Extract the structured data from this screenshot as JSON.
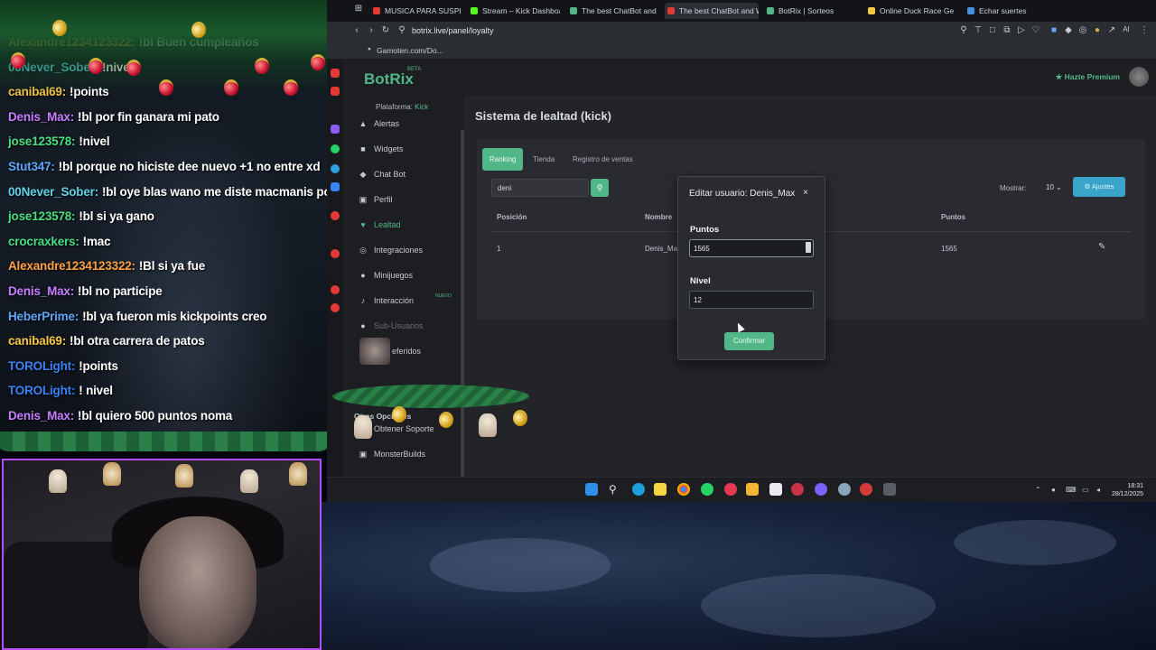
{
  "browser": {
    "tabs": [
      {
        "label": "MUSICA PARA SUSPE",
        "color": "#e53935",
        "active": false
      },
      {
        "label": "Stream – Kick Dashboard",
        "color": "#53fc18",
        "active": false
      },
      {
        "label": "The best ChatBot and Wi",
        "color": "#52b788",
        "active": false
      },
      {
        "label": "The best ChatBot and Wi",
        "color": "#e53935",
        "active": true
      },
      {
        "label": "BotRix | Sorteos",
        "color": "#52b788",
        "active": false
      },
      {
        "label": "Online Duck Race Ge",
        "color": "#f6c744",
        "active": false
      },
      {
        "label": "Echar suertes",
        "color": "#4a90e2",
        "active": false
      }
    ],
    "url": "botrix.live/panel/loyalty",
    "bookmark": "Gamoten.com/Do..."
  },
  "app": {
    "logo": "BotRix",
    "logo_beta": "BETA",
    "premium": "Hazte Premium",
    "platform_label": "Plataforma:",
    "platform_value": "Kick",
    "nav": [
      {
        "label": "Alertas",
        "icon": "bell-icon",
        "glyph": "▲",
        "state": "normal"
      },
      {
        "label": "Widgets",
        "icon": "widgets-icon",
        "glyph": "■",
        "state": "normal"
      },
      {
        "label": "Chat Bot",
        "icon": "chat-bot-icon",
        "glyph": "◆",
        "state": "normal"
      },
      {
        "label": "Perfil",
        "icon": "profile-icon",
        "glyph": "▣",
        "state": "normal"
      },
      {
        "label": "Lealtad",
        "icon": "loyalty-icon",
        "glyph": "♥",
        "state": "active"
      },
      {
        "label": "Integraciones",
        "icon": "integrations-icon",
        "glyph": "◎",
        "state": "normal"
      },
      {
        "label": "Minijuegos",
        "icon": "gamepad-icon",
        "glyph": "●",
        "state": "normal"
      },
      {
        "label": "Interacción",
        "icon": "music-icon",
        "glyph": "♪",
        "state": "normal"
      },
      {
        "label": "Sub-Usuarios",
        "icon": "users-icon",
        "glyph": "●",
        "state": "dim"
      },
      {
        "label": "eferidos",
        "icon": "referrals-icon",
        "glyph": "",
        "state": "normal"
      }
    ],
    "nav_badge_nuevo": "NUEVO",
    "other_options": "Otras Opciones",
    "nav_bottom": [
      {
        "label": "Obtener Soporte",
        "icon": "support-icon",
        "glyph": "?"
      },
      {
        "label": "MonsterBuilds",
        "icon": "monster-icon",
        "glyph": "▣"
      }
    ],
    "page_title": "Sistema de lealtad (kick)",
    "tabs": [
      "Ranking",
      "Tienda",
      "Registro de ventas"
    ],
    "search_value": "deni",
    "show_label": "Mostrar:",
    "show_value": "10",
    "settings_label": "Ajustes",
    "table": {
      "headers": [
        "Posición",
        "Nombre",
        "Puntos"
      ],
      "rows": [
        {
          "pos": "1",
          "name": "Denis_Ma",
          "points": "1565"
        }
      ]
    }
  },
  "modal": {
    "title": "Editar usuario: Denis_Max",
    "close": "×",
    "points_label": "Puntos",
    "points_value": "1565",
    "level_label": "Nivel",
    "level_value": "12",
    "confirm": "Confirmar"
  },
  "chat": {
    "messages": [
      {
        "user": "Alexandre1234123322:",
        "text": "!bl Buen cumpleaños",
        "color": "#ff9f43"
      },
      {
        "user": "00Never_Sober:",
        "text": "!nivel",
        "color": "#5fd3e6"
      },
      {
        "user": "canibal69:",
        "text": "!points",
        "color": "#f6c744"
      },
      {
        "user": "Denis_Max:",
        "text": "!bl por fin ganara mi pato",
        "color": "#c77dff"
      },
      {
        "user": "jose123578:",
        "text": "!nivel",
        "color": "#4ade80"
      },
      {
        "user": "Stut347:",
        "text": "!bl porque no hiciste dee nuevo +1 no entre xd",
        "color": "#60a5fa"
      },
      {
        "user": "00Never_Sober:",
        "text": "!bl oye blas wano me diste macmanis por el",
        "color": "#5fd3e6"
      },
      {
        "user": "jose123578:",
        "text": "!bl si ya gano",
        "color": "#4ade80"
      },
      {
        "user": "crocraxkers:",
        "text": "!mac",
        "color": "#4ade80"
      },
      {
        "user": "Alexandre1234123322:",
        "text": "!Bl si ya fue",
        "color": "#ff9f43"
      },
      {
        "user": "Denis_Max:",
        "text": "!bl no participe",
        "color": "#c77dff"
      },
      {
        "user": "HeberPrime:",
        "text": "!bl ya fueron mis kickpoints creo",
        "color": "#60a5fa"
      },
      {
        "user": "canibal69:",
        "text": "!bl otra carrera de patos",
        "color": "#f6c744"
      },
      {
        "user": "TOROLight:",
        "text": "!points",
        "color": "#3b82f6"
      },
      {
        "user": "TOROLight:",
        "text": "! nivel",
        "color": "#3b82f6"
      },
      {
        "user": "Denis_Max:",
        "text": "!bl quiero 500 puntos noma",
        "color": "#c77dff"
      }
    ]
  },
  "taskbar": {
    "time": "18:31",
    "date": "28/12/2025"
  }
}
